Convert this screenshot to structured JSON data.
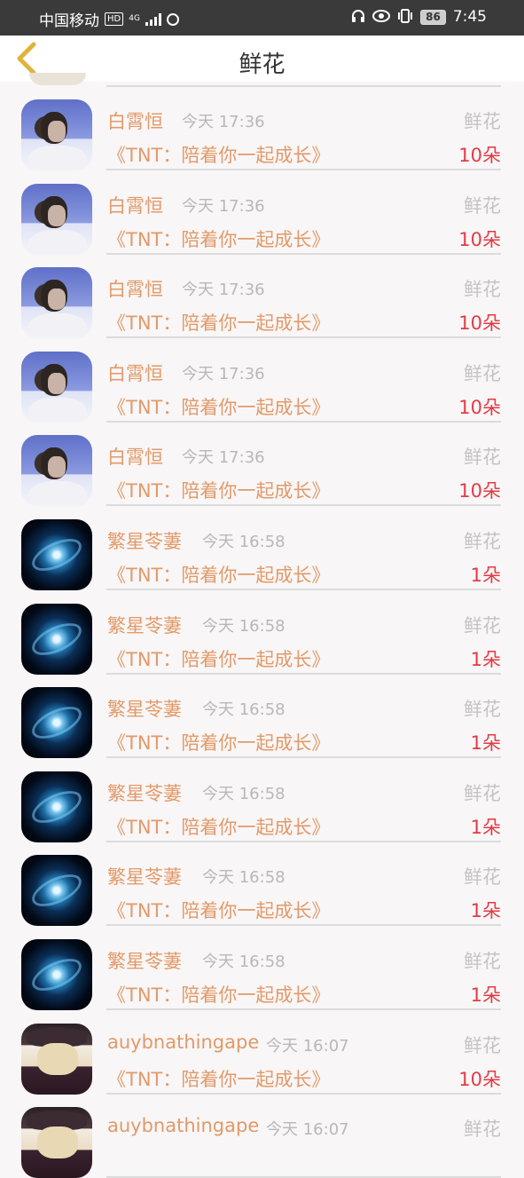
{
  "status_bar": {
    "carrier": "中国移动",
    "hd": "HD",
    "network": "4G",
    "battery": "86",
    "time": "7:45",
    "icons": [
      "headphones-icon",
      "eye-icon",
      "vibrate-icon"
    ]
  },
  "header": {
    "title": "鲜花",
    "back_icon": "chevron-left-icon"
  },
  "colors": {
    "name": "#e29a68",
    "time": "#b8b8b8",
    "category": "#c4c4c4",
    "count": "#e23b45",
    "back_arrow": "#e0b43a"
  },
  "rows": [
    {
      "avatar": "person",
      "name": "白霄恒",
      "time": "今天 17:36",
      "category": "鲜花",
      "book": "《TNT：陪着你一起成长》",
      "count": "10朵"
    },
    {
      "avatar": "person",
      "name": "白霄恒",
      "time": "今天 17:36",
      "category": "鲜花",
      "book": "《TNT：陪着你一起成长》",
      "count": "10朵"
    },
    {
      "avatar": "person",
      "name": "白霄恒",
      "time": "今天 17:36",
      "category": "鲜花",
      "book": "《TNT：陪着你一起成长》",
      "count": "10朵"
    },
    {
      "avatar": "person",
      "name": "白霄恒",
      "time": "今天 17:36",
      "category": "鲜花",
      "book": "《TNT：陪着你一起成长》",
      "count": "10朵"
    },
    {
      "avatar": "person",
      "name": "白霄恒",
      "time": "今天 17:36",
      "category": "鲜花",
      "book": "《TNT：陪着你一起成长》",
      "count": "10朵"
    },
    {
      "avatar": "galaxy",
      "name": "繁星苓萋",
      "time": "今天 16:58",
      "category": "鲜花",
      "book": "《TNT：陪着你一起成长》",
      "count": "1朵"
    },
    {
      "avatar": "galaxy",
      "name": "繁星苓萋",
      "time": "今天 16:58",
      "category": "鲜花",
      "book": "《TNT：陪着你一起成长》",
      "count": "1朵"
    },
    {
      "avatar": "galaxy",
      "name": "繁星苓萋",
      "time": "今天 16:58",
      "category": "鲜花",
      "book": "《TNT：陪着你一起成长》",
      "count": "1朵"
    },
    {
      "avatar": "galaxy",
      "name": "繁星苓萋",
      "time": "今天 16:58",
      "category": "鲜花",
      "book": "《TNT：陪着你一起成长》",
      "count": "1朵"
    },
    {
      "avatar": "galaxy",
      "name": "繁星苓萋",
      "time": "今天 16:58",
      "category": "鲜花",
      "book": "《TNT：陪着你一起成长》",
      "count": "1朵"
    },
    {
      "avatar": "galaxy",
      "name": "繁星苓萋",
      "time": "今天 16:58",
      "category": "鲜花",
      "book": "《TNT：陪着你一起成长》",
      "count": "1朵"
    },
    {
      "avatar": "anime",
      "name": "auybnathingape",
      "time": "今天 16:07",
      "category": "鲜花",
      "book": "《TNT：陪着你一起成长》",
      "count": "10朵"
    },
    {
      "avatar": "anime",
      "name": "auybnathingape",
      "time": "今天 16:07",
      "category": "鲜花",
      "book": "",
      "count": ""
    }
  ]
}
